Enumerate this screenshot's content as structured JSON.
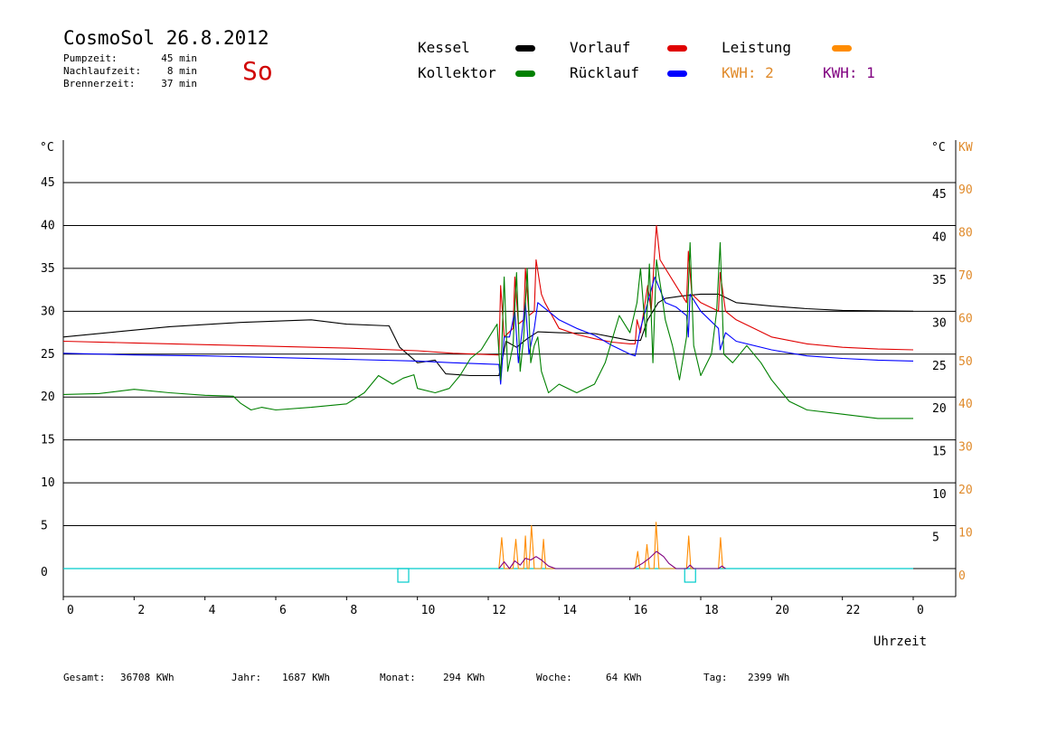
{
  "header": {
    "title": "CosmoSol 26.8.2012",
    "weekday": "So",
    "info": [
      {
        "label": "Pumpzeit:",
        "value": "45 min"
      },
      {
        "label": "Nachlaufzeit:",
        "value": "8 min"
      },
      {
        "label": "Brennerzeit:",
        "value": "37 min"
      }
    ]
  },
  "legend": {
    "kessel": {
      "label": "Kessel",
      "color": "#000000"
    },
    "kollektor": {
      "label": "Kollektor",
      "color": "#008000"
    },
    "vorlauf": {
      "label": "Vorlauf",
      "color": "#e00000"
    },
    "ruecklauf": {
      "label": "Rücklauf",
      "color": "#0000ff"
    },
    "leistung": {
      "label": "Leistung",
      "color": "#ff8c00"
    },
    "kwh2": {
      "label": "KWH: 2",
      "color": "#ff8c00"
    },
    "kwh1": {
      "label": "KWH: 1",
      "color": "#800080"
    }
  },
  "footer": [
    {
      "label": "Gesamt:",
      "value": "36708 KWh"
    },
    {
      "label": "Jahr:",
      "value": "1687 KWh"
    },
    {
      "label": "Monat:",
      "value": "294 KWh"
    },
    {
      "label": "Woche:",
      "value": "64 KWh"
    },
    {
      "label": "Tag:",
      "value": "2399 Wh"
    }
  ],
  "chart_data": {
    "type": "line",
    "title": "CosmoSol 26.8.2012",
    "xlabel": "Uhrzeit",
    "ylabel_left": "°C",
    "ylabel_right_temp": "°C",
    "ylabel_right_power": "KW",
    "xlim": [
      0,
      24
    ],
    "ylim": [
      0,
      50
    ],
    "x_tick_labels": [
      "0",
      "2",
      "4",
      "6",
      "8",
      "10",
      "12",
      "14",
      "16",
      "18",
      "20",
      "22",
      "0"
    ],
    "y_tick_labels_left": [
      "0",
      "5",
      "10",
      "15",
      "20",
      "25",
      "30",
      "35",
      "40",
      "45"
    ],
    "y_tick_labels_right_temp": [
      "5",
      "10",
      "15",
      "20",
      "25",
      "30",
      "35",
      "40",
      "45"
    ],
    "y_tick_labels_right_power": [
      "0",
      "10",
      "20",
      "30",
      "40",
      "50",
      "60",
      "70",
      "80",
      "90"
    ],
    "grid": "horizontal",
    "series": [
      {
        "name": "Kessel",
        "color": "#000000",
        "points": [
          [
            0,
            27.0
          ],
          [
            1.5,
            27.6
          ],
          [
            3,
            28.2
          ],
          [
            5,
            28.7
          ],
          [
            7,
            29.0
          ],
          [
            8,
            28.5
          ],
          [
            9.2,
            28.3
          ],
          [
            9.5,
            25.8
          ],
          [
            10,
            24.0
          ],
          [
            10.5,
            24.3
          ],
          [
            10.8,
            22.7
          ],
          [
            11.5,
            22.5
          ],
          [
            12.3,
            22.5
          ],
          [
            12.5,
            26.5
          ],
          [
            12.8,
            25.8
          ],
          [
            13.1,
            26.8
          ],
          [
            13.4,
            27.6
          ],
          [
            14,
            27.5
          ],
          [
            15,
            27.4
          ],
          [
            15.5,
            27.0
          ],
          [
            16,
            26.6
          ],
          [
            16.3,
            26.6
          ],
          [
            16.5,
            29.0
          ],
          [
            16.8,
            31.0
          ],
          [
            17,
            31.5
          ],
          [
            17.5,
            31.8
          ],
          [
            18,
            32.0
          ],
          [
            18.5,
            32.0
          ],
          [
            19,
            31.0
          ],
          [
            20,
            30.6
          ],
          [
            21,
            30.3
          ],
          [
            22,
            30.1
          ],
          [
            24,
            30.0
          ]
        ]
      },
      {
        "name": "Vorlauf",
        "color": "#e00000",
        "points": [
          [
            0,
            26.5
          ],
          [
            2,
            26.3
          ],
          [
            4,
            26.1
          ],
          [
            6,
            25.9
          ],
          [
            8,
            25.7
          ],
          [
            10,
            25.4
          ],
          [
            11,
            25.1
          ],
          [
            12.3,
            24.9
          ],
          [
            12.35,
            33.0
          ],
          [
            12.45,
            27.0
          ],
          [
            12.7,
            28.0
          ],
          [
            12.75,
            34.0
          ],
          [
            12.85,
            28.5
          ],
          [
            13.0,
            29.0
          ],
          [
            13.05,
            35.0
          ],
          [
            13.15,
            29.5
          ],
          [
            13.3,
            30.0
          ],
          [
            13.35,
            36.0
          ],
          [
            13.5,
            32.0
          ],
          [
            13.6,
            31.0
          ],
          [
            14,
            28.0
          ],
          [
            14.5,
            27.3
          ],
          [
            15,
            26.8
          ],
          [
            15.5,
            26.4
          ],
          [
            16,
            26.2
          ],
          [
            16.15,
            26.2
          ],
          [
            16.2,
            29.0
          ],
          [
            16.3,
            27.5
          ],
          [
            16.5,
            33.0
          ],
          [
            16.6,
            30.0
          ],
          [
            16.7,
            37.0
          ],
          [
            16.75,
            40.0
          ],
          [
            16.85,
            36.0
          ],
          [
            17,
            35.0
          ],
          [
            17.3,
            33.0
          ],
          [
            17.6,
            31.0
          ],
          [
            17.65,
            37.0
          ],
          [
            17.75,
            32.0
          ],
          [
            18,
            31.0
          ],
          [
            18.5,
            30.0
          ],
          [
            18.55,
            34.5
          ],
          [
            18.7,
            30.0
          ],
          [
            19,
            29.0
          ],
          [
            19.5,
            28.0
          ],
          [
            20,
            27.0
          ],
          [
            21,
            26.2
          ],
          [
            22,
            25.8
          ],
          [
            23,
            25.6
          ],
          [
            24,
            25.5
          ]
        ]
      },
      {
        "name": "Rücklauf",
        "color": "#0000ff",
        "points": [
          [
            0,
            25.1
          ],
          [
            2,
            24.9
          ],
          [
            4,
            24.8
          ],
          [
            6,
            24.6
          ],
          [
            8,
            24.4
          ],
          [
            10,
            24.2
          ],
          [
            11,
            24.0
          ],
          [
            12.3,
            23.8
          ],
          [
            12.35,
            21.5
          ],
          [
            12.45,
            27.0
          ],
          [
            12.6,
            27.0
          ],
          [
            12.75,
            30.0
          ],
          [
            12.85,
            24.0
          ],
          [
            13.05,
            31.0
          ],
          [
            13.15,
            25.0
          ],
          [
            13.3,
            28.0
          ],
          [
            13.4,
            31.0
          ],
          [
            13.7,
            30.0
          ],
          [
            14,
            29.0
          ],
          [
            14.5,
            28.0
          ],
          [
            15,
            27.2
          ],
          [
            15.5,
            26.0
          ],
          [
            16,
            25.0
          ],
          [
            16.15,
            24.8
          ],
          [
            16.3,
            28.0
          ],
          [
            16.5,
            31.0
          ],
          [
            16.7,
            34.0
          ],
          [
            16.8,
            33.0
          ],
          [
            17,
            31.0
          ],
          [
            17.3,
            30.5
          ],
          [
            17.6,
            29.5
          ],
          [
            17.65,
            27.0
          ],
          [
            17.7,
            32.0
          ],
          [
            18,
            30.0
          ],
          [
            18.5,
            28.0
          ],
          [
            18.55,
            25.5
          ],
          [
            18.7,
            27.5
          ],
          [
            19,
            26.5
          ],
          [
            20,
            25.5
          ],
          [
            21,
            24.8
          ],
          [
            22,
            24.5
          ],
          [
            23,
            24.3
          ],
          [
            24,
            24.2
          ]
        ]
      },
      {
        "name": "Kollektor",
        "color": "#008000",
        "points": [
          [
            0,
            20.3
          ],
          [
            1,
            20.4
          ],
          [
            2,
            20.9
          ],
          [
            3,
            20.5
          ],
          [
            4,
            20.2
          ],
          [
            4.8,
            20.1
          ],
          [
            5.0,
            19.3
          ],
          [
            5.3,
            18.5
          ],
          [
            5.6,
            18.8
          ],
          [
            6,
            18.5
          ],
          [
            7,
            18.8
          ],
          [
            8,
            19.2
          ],
          [
            8.5,
            20.5
          ],
          [
            8.9,
            22.5
          ],
          [
            9.3,
            21.5
          ],
          [
            9.6,
            22.2
          ],
          [
            9.9,
            22.6
          ],
          [
            10.0,
            21.0
          ],
          [
            10.5,
            20.5
          ],
          [
            10.9,
            21.0
          ],
          [
            11.2,
            22.5
          ],
          [
            11.5,
            24.5
          ],
          [
            11.8,
            25.5
          ],
          [
            12.1,
            27.5
          ],
          [
            12.25,
            28.5
          ],
          [
            12.35,
            22.0
          ],
          [
            12.45,
            34.0
          ],
          [
            12.55,
            23.0
          ],
          [
            12.7,
            26.0
          ],
          [
            12.8,
            34.5
          ],
          [
            12.9,
            23.0
          ],
          [
            13.0,
            27.0
          ],
          [
            13.1,
            35.0
          ],
          [
            13.2,
            24.0
          ],
          [
            13.3,
            26.0
          ],
          [
            13.4,
            27.0
          ],
          [
            13.5,
            23.0
          ],
          [
            13.7,
            20.5
          ],
          [
            14.0,
            21.5
          ],
          [
            14.5,
            20.5
          ],
          [
            15.0,
            21.5
          ],
          [
            15.3,
            24.0
          ],
          [
            15.7,
            29.5
          ],
          [
            16.0,
            27.5
          ],
          [
            16.2,
            31.0
          ],
          [
            16.3,
            35.0
          ],
          [
            16.45,
            27.0
          ],
          [
            16.55,
            35.5
          ],
          [
            16.65,
            24.0
          ],
          [
            16.75,
            36.0
          ],
          [
            16.9,
            32.0
          ],
          [
            17.0,
            29.0
          ],
          [
            17.2,
            26.0
          ],
          [
            17.4,
            22.0
          ],
          [
            17.6,
            27.0
          ],
          [
            17.7,
            38.0
          ],
          [
            17.8,
            26.0
          ],
          [
            18.0,
            22.5
          ],
          [
            18.3,
            25.0
          ],
          [
            18.45,
            30.0
          ],
          [
            18.55,
            38.0
          ],
          [
            18.65,
            25.0
          ],
          [
            18.9,
            24.0
          ],
          [
            19.3,
            26.0
          ],
          [
            19.7,
            24.0
          ],
          [
            20,
            22.0
          ],
          [
            20.5,
            19.5
          ],
          [
            21,
            18.5
          ],
          [
            22,
            18.0
          ],
          [
            23,
            17.5
          ],
          [
            24,
            17.5
          ]
        ]
      },
      {
        "name": "Leistung",
        "color": "#ff8c00",
        "points": [
          [
            12.3,
            0
          ],
          [
            12.38,
            3.6
          ],
          [
            12.45,
            0
          ],
          [
            12.7,
            0
          ],
          [
            12.78,
            3.4
          ],
          [
            12.85,
            0
          ],
          [
            13.0,
            0
          ],
          [
            13.05,
            3.8
          ],
          [
            13.1,
            0
          ],
          [
            13.15,
            0
          ],
          [
            13.22,
            5.0
          ],
          [
            13.3,
            0
          ],
          [
            13.5,
            0
          ],
          [
            13.56,
            3.4
          ],
          [
            13.62,
            0
          ],
          [
            16.15,
            0
          ],
          [
            16.22,
            2.0
          ],
          [
            16.28,
            0
          ],
          [
            16.42,
            0
          ],
          [
            16.48,
            2.8
          ],
          [
            16.55,
            0
          ],
          [
            16.68,
            0
          ],
          [
            16.74,
            5.4
          ],
          [
            16.82,
            0
          ],
          [
            17.6,
            0
          ],
          [
            17.66,
            3.8
          ],
          [
            17.72,
            0
          ],
          [
            18.5,
            0
          ],
          [
            18.56,
            3.6
          ],
          [
            18.62,
            0
          ]
        ]
      },
      {
        "name": "KWH",
        "color": "#800080",
        "points": [
          [
            12.3,
            0
          ],
          [
            12.45,
            0.8
          ],
          [
            12.6,
            0
          ],
          [
            12.75,
            0.9
          ],
          [
            12.9,
            0.4
          ],
          [
            13.05,
            1.2
          ],
          [
            13.2,
            1.0
          ],
          [
            13.35,
            1.4
          ],
          [
            13.5,
            1.0
          ],
          [
            13.7,
            0.3
          ],
          [
            13.9,
            0
          ],
          [
            16.1,
            0
          ],
          [
            16.35,
            0.6
          ],
          [
            16.55,
            1.2
          ],
          [
            16.75,
            2.0
          ],
          [
            16.95,
            1.4
          ],
          [
            17.1,
            0.6
          ],
          [
            17.3,
            0
          ],
          [
            17.6,
            0
          ],
          [
            17.7,
            0.4
          ],
          [
            17.8,
            0
          ],
          [
            18.5,
            0
          ],
          [
            18.6,
            0.3
          ],
          [
            18.7,
            0
          ]
        ]
      }
    ],
    "markers": {
      "name": "Pumpe",
      "color": "#00cccc",
      "x": [
        9.6,
        17.7
      ]
    }
  }
}
